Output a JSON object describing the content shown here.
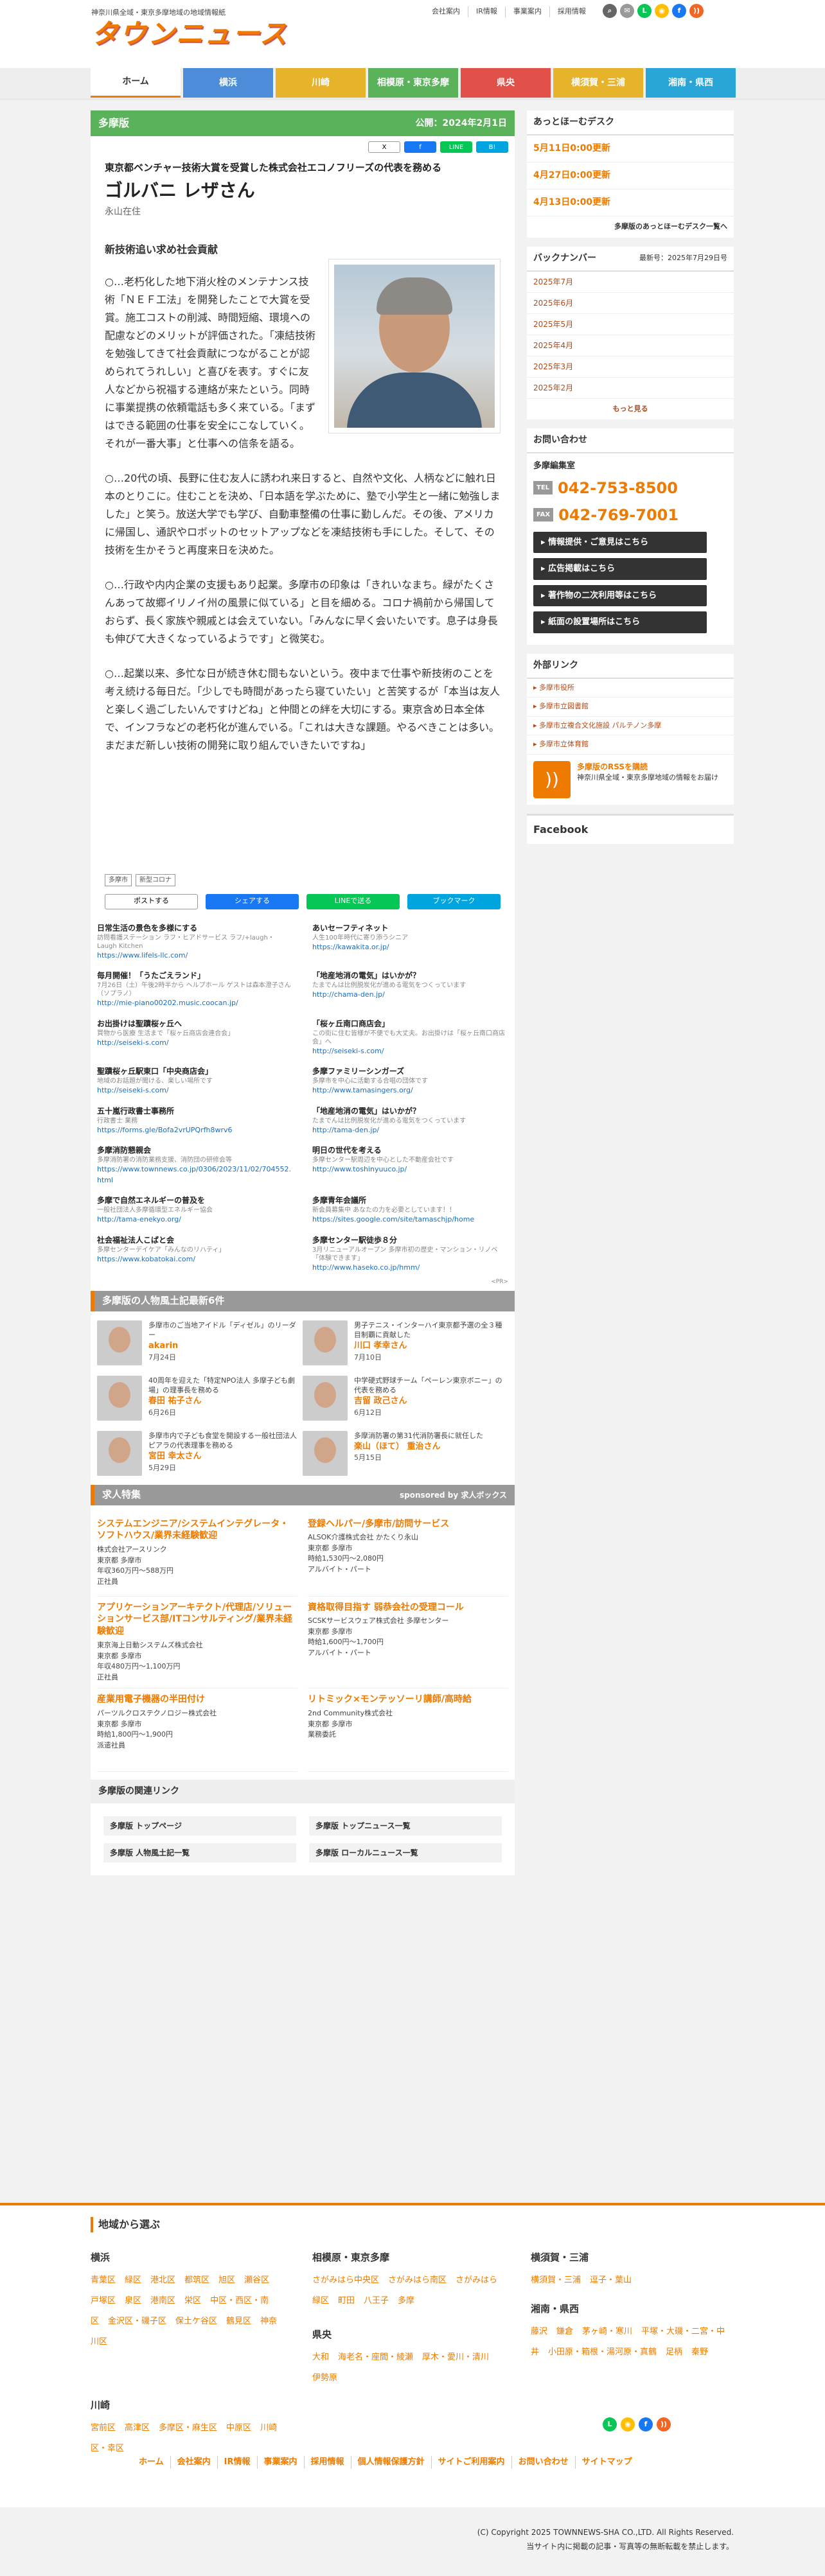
{
  "header": {
    "tagline": "神奈川県全域・東京多摩地域の地域情報紙",
    "logo": "タウンニュース",
    "links": [
      "会社案内",
      "IR情報",
      "事業案内",
      "採用情報"
    ]
  },
  "nav": [
    "ホーム",
    "横浜",
    "川崎",
    "相模原・東京多摩",
    "県央",
    "横須賀・三浦",
    "湘南・県西"
  ],
  "colors": {
    "accent": "#ee7b00",
    "nav": [
      "#ffffff",
      "#4c8cd8",
      "#e6b32a",
      "#5ab25a",
      "#e2504a",
      "#e6b32a",
      "#2aa5d8"
    ]
  },
  "category": {
    "name": "多摩版",
    "date": "公開：2024年2月1日"
  },
  "share_top": [
    "X",
    "f",
    "LINE",
    "B!"
  ],
  "article": {
    "subtitle": "東京都ベンチャー技術大賞を受賞した株式会社エコノフリーズの代表を務める",
    "name": "ゴルバニ レザさん",
    "place": "永山在住",
    "heading": "新技術追い求め社会貢献",
    "paragraphs": [
      "○…老朽化した地下消火栓のメンテナンス技術「ＮＥＦ工法」を開発したことで大賞を受賞。施工コストの削減、時間短縮、環境への配慮などのメリットが評価された。「凍結技術を勉強してきて社会貢献につながることが認められてうれしい」と喜びを表す。すぐに友人などから祝福する連絡が来たという。同時に事業提携の依頼電話も多く来ている。「まずはできる範囲の仕事を安全にこなしていく。それが一番大事」と仕事への信条を語る。",
      "○…20代の頃、長野に住む友人に誘われ来日すると、自然や文化、人柄などに触れ日本のとりこに。住むことを決め、「日本語を学ぶために、塾で小学生と一緒に勉強しました」と笑う。放送大学でも学び、自動車整備の仕事に勤しんだ。その後、アメリカに帰国し、通訳やロボットのセットアップなどを凍結技術も手にした。そして、その技術を生かそうと再度来日を決めた。",
      "○…行政や内内企業の支援もあり起業。多摩市の印象は「きれいなまち。緑がたくさんあって故郷イリノイ州の風景に似ている」と目を細める。コロナ禍前から帰国しておらず、長く家族や親戚とは会えていない。「みんなに早く会いたいです。息子は身長も伸びて大きくなっているようです」と微笑む。",
      "○…起業以来、多忙な日が続き休む間もないという。夜中まで仕事や新技術のことを考え続ける毎日だ。「少しでも時間があったら寝ていたい」と苦笑するが「本当は友人と楽しく過ごしたいんですけどね」と仲間との絆を大切にする。東京含め日本全体で、インフラなどの老朽化が進んでいる。「これは大きな課題。やるべきことは多い。まだまだ新しい技術の開発に取り組んでいきたいですね」"
    ],
    "tags": [
      "多摩市",
      "新型コロナ"
    ]
  },
  "share_bottom": [
    "ポストする",
    "シェアする",
    "LINEで送る",
    "ブックマーク"
  ],
  "pr": [
    {
      "t": "日常生活の景色を多様にする",
      "d": "訪問看護ステーション ラフ・ヒアドサービス ラフ/+laugh・Laugh Kitchen",
      "u": "https://www.lifels-llc.com/"
    },
    {
      "t": "あいセーフティネット",
      "d": "人生100年時代に寄り添うシニア",
      "u": "https://kawakita.or.jp/"
    },
    {
      "t": "毎月開催！「うたごえランド」",
      "d": "7月26日（土）午後2時半から ヘルプホール ゲストは森本澄子さん（ソプラノ）",
      "u": "http://mie-piano00202.music.coocan.jp/"
    },
    {
      "t": "「地産地消の電気」はいかが？",
      "d": "たまでんは比例脱炭化が進める電気をつくっています",
      "u": "http://chama-den.jp/"
    },
    {
      "t": "お出掛けは聖蹟桜ヶ丘へ",
      "d": "買物から医療 生活まで「桜ヶ丘商店会連合会」",
      "u": "http://seiseki-s.com/"
    },
    {
      "t": "「桜ヶ丘南口商店会」",
      "d": "この街に住む皆様が不便でも大丈夫。お出掛けは「桜ヶ丘南口商店会」へ",
      "u": "http://seiseki-s.com/"
    },
    {
      "t": "聖蹟桜ヶ丘駅東口「中央商店会」",
      "d": "地域のお話題が聞ける、楽しい場所です",
      "u": "http://seiseki-s.com/"
    },
    {
      "t": "多摩ファミリーシンガーズ",
      "d": "多摩市を中心に活動する合唱の団体です",
      "u": "http://www.tamasingers.org/"
    },
    {
      "t": "五十嵐行政書士事務所",
      "d": "行政書士 業務",
      "u": "https://forms.gle/Bofa2vrUPQrfh8wrv6"
    },
    {
      "t": "「地産地消の電気」はいかが？",
      "d": "たまでんは比例脱炭化が進める電気をつくっています",
      "u": "http://tama-den.jp/"
    },
    {
      "t": "多摩消防懇親会",
      "d": "多摩消防署の消防業務支援、消防団の研修会等",
      "u": "https://www.townnews.co.jp/0306/2023/11/02/704552.html"
    },
    {
      "t": "明日の世代を考える",
      "d": "多摩センター駅周辺を中心とした不動産会社です",
      "u": "http://www.toshinyuuco.jp/"
    },
    {
      "t": "多摩で自然エネルギーの普及を",
      "d": "一般社団法人多摩循環型エネルギー協会",
      "u": "http://tama-enekyo.org/"
    },
    {
      "t": "多摩青年会議所",
      "d": "新会員募集中 あなたの力を必要としています！！",
      "u": "https://sites.google.com/site/tamaschjp/home"
    },
    {
      "t": "社会福祉法人こばと会",
      "d": "多摩センターデイケア「みんなのリハティ」",
      "u": "https://www.kobatokai.com/"
    },
    {
      "t": "多摩センター駅徒歩８分",
      "d": "3月リニューアルオープン 多摩市初の歴史・マンション・リノベ「体験できます」",
      "u": "http://www.haseko.co.jp/hmm/"
    }
  ],
  "pr_tag": "<PR>",
  "people": {
    "title": "多摩版の人物風土記最新6件",
    "items": [
      {
        "desc": "多摩市のご当地アイドル「ディゼル」のリーダー",
        "name": "akarin",
        "date": "7月24日"
      },
      {
        "desc": "男子テニス・インターハイ東京都予選の全３種目制覇に貢献した",
        "name": "川口 孝幸さん",
        "date": "7月10日"
      },
      {
        "desc": "40周年を迎えた「特定NPO法人 多摩子ども劇場」の理事長を務める",
        "name": "春田 祐子さん",
        "date": "6月26日"
      },
      {
        "desc": "中学硬式野球チーム「ペーレン東京ボニー」の代表を務める",
        "name": "吉留 政己さん",
        "date": "6月12日"
      },
      {
        "desc": "多摩市内で子ども食堂を開設する一般社団法人ピアラの代表理事を務める",
        "name": "宮田 幸太さん",
        "date": "5月29日"
      },
      {
        "desc": "多摩消防署の第31代消防署長に就任した",
        "name": "楽山（ほて） 重治さん",
        "date": "5月15日"
      }
    ]
  },
  "jobs": {
    "title": "求人特集",
    "sponsor": "sponsored by 求人ボックス",
    "items": [
      {
        "t": "システムエンジニア/システムインテグレータ・ソフトハウス/業界未経験歓迎",
        "c": [
          "株式会社アースリンク",
          "東京都 多摩市",
          "年収360万円〜588万円",
          "正社員"
        ]
      },
      {
        "t": "登録ヘルパー/多摩市/訪問サービス",
        "c": [
          "ALSOK介護株式会社 かたくり永山",
          "東京都 多摩市",
          "時給1,530円〜2,080円",
          "アルバイト・パート"
        ]
      },
      {
        "t": "アプリケーションアーキテクト/代理店/ソリューションサービス部/ITコンサルティング/業界未経験歓迎",
        "c": [
          "東京海上日動システムズ株式会社",
          "東京都 多摩市",
          "年収480万円〜1,100万円",
          "正社員"
        ]
      },
      {
        "t": "資格取得目指す 弱恭会社の受理コール",
        "c": [
          "SCSKサービスウェア株式会社 多摩センター",
          "東京都 多摩市",
          "時給1,600円〜1,700円",
          "アルバイト・パート"
        ]
      },
      {
        "t": "産業用電子機器の半田付け",
        "c": [
          "パーツルクロステクノロジー株式会社",
          "東京都 多摩市",
          "時給1,800円〜1,900円",
          "派遣社員"
        ]
      },
      {
        "t": "リトミック×モンテッソーリ講師/高時給",
        "c": [
          "2nd Community株式会社",
          "東京都 多摩市",
          "業務委託"
        ]
      }
    ]
  },
  "related": {
    "title": "多摩版の関連リンク",
    "links": [
      "多摩版 トップページ",
      "多摩版 トップニュース一覧",
      "多摩版 人物風土記一覧",
      "多摩版 ローカルニュース一覧"
    ]
  },
  "sidebar": {
    "desk": {
      "title": "あっとほーむデスク",
      "items": [
        "5月11日0:00更新",
        "4月27日0:00更新",
        "4月13日0:00更新"
      ],
      "more": "多摩版のあっとほーむデスク一覧へ"
    },
    "backnumber": {
      "title": "バックナンバー",
      "latest": "最新号：2025年7月29日号",
      "items": [
        "2025年7月",
        "2025年6月",
        "2025年5月",
        "2025年4月",
        "2025年3月",
        "2025年2月"
      ],
      "more": "もっと見る"
    },
    "contact": {
      "title": "お問い合わせ",
      "office": "多摩編集室",
      "tel_label": "TEL",
      "tel": "042-753-8500",
      "fax_label": "FAX",
      "fax": "042-769-7001",
      "buttons": [
        "情報提供・ご意見はこちら",
        "広告掲載はこちら",
        "著作物の二次利用等はこちら",
        "紙面の設置場所はこちら"
      ]
    },
    "external": {
      "title": "外部リンク",
      "items": [
        "多摩市役所",
        "多摩市立図書館",
        "多摩市立複合文化施設 パルテノン多摩",
        "多摩市立体育館"
      ]
    },
    "rss": {
      "text": "多摩版のRSSを購読",
      "sub": "神奈川県全域・東京多摩地域の情報をお届け"
    },
    "facebook": "Facebook"
  },
  "footer": {
    "title": "地域から選ぶ",
    "regions": [
      {
        "name": "横浜",
        "areas": [
          "青葉区",
          "緑区",
          "港北区",
          "都筑区",
          "旭区",
          "瀬谷区",
          "戸塚区",
          "泉区",
          "港南区",
          "栄区",
          "中区・西区・南区",
          "金沢区・磯子区",
          "保土ケ谷区",
          "鶴見区",
          "神奈川区"
        ]
      },
      {
        "name": "相模原・東京多摩",
        "areas": [
          "さがみはら中央区",
          "さがみはら南区",
          "さがみはら緑区",
          "町田",
          "八王子",
          "多摩"
        ]
      },
      {
        "name": "横須賀・三浦",
        "areas": [
          "横須賀・三浦",
          "逗子・葉山"
        ]
      },
      {
        "name": "川崎",
        "areas": [
          "宮前区",
          "高津区",
          "多摩区・麻生区",
          "中原区",
          "川崎区・幸区"
        ]
      },
      {
        "name": "県央",
        "areas": [
          "大和",
          "海老名・座間・綾瀬",
          "厚木・愛川・清川",
          "伊勢原"
        ]
      },
      {
        "name": "湘南・県西",
        "areas": [
          "藤沢",
          "鎌倉",
          "茅ヶ崎・寒川",
          "平塚・大磯・二宮・中井",
          "小田原・箱根・湯河原・真鶴",
          "足柄",
          "秦野"
        ]
      }
    ],
    "links": [
      "ホーム",
      "会社案内",
      "IR情報",
      "事業案内",
      "採用情報",
      "個人情報保護方針",
      "サイトご利用案内",
      "お問い合わせ",
      "サイトマップ"
    ],
    "copyright": "(C) Copyright 2025 TOWNNEWS-SHA CO.,LTD. All Rights Reserved.",
    "notice": "当サイト内に掲載の記事・写真等の無断転載を禁止します。"
  }
}
